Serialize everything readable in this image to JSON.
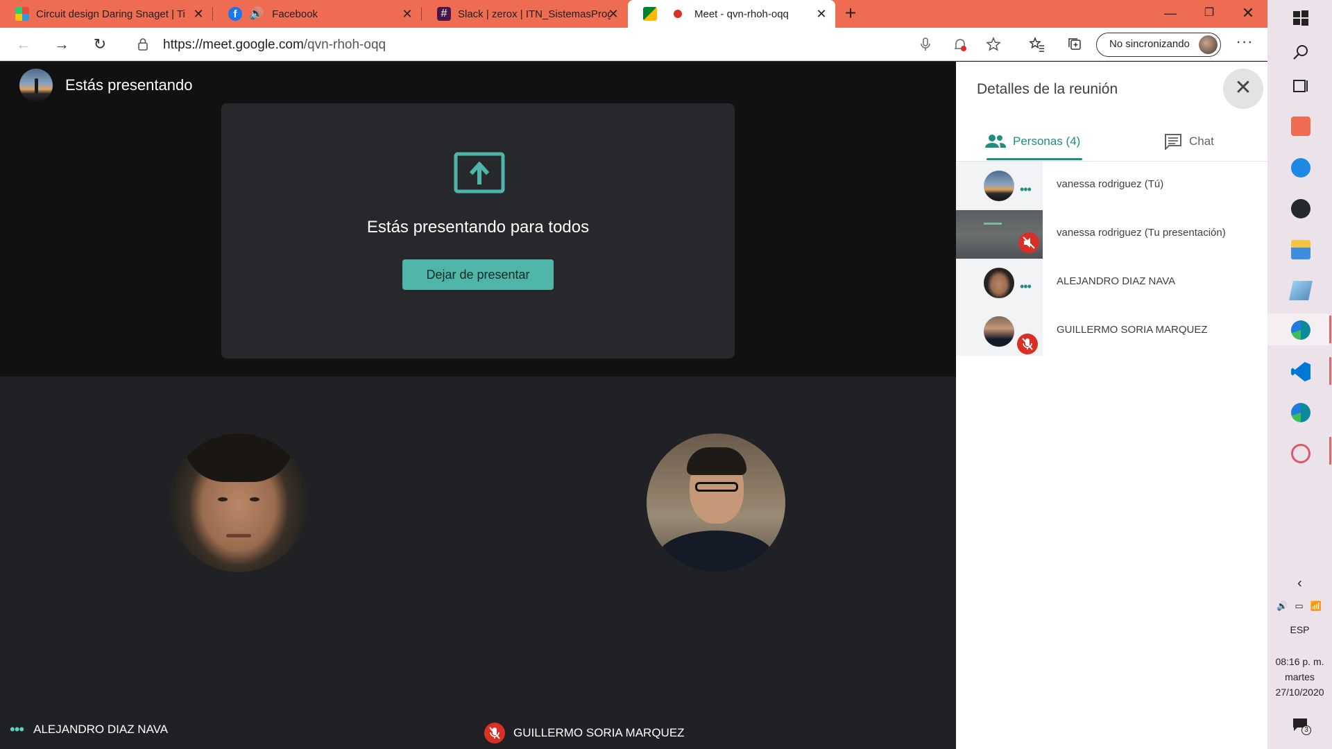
{
  "browser": {
    "tabs": [
      {
        "title": "Circuit design Daring Snaget | Ti",
        "favicon": "tinkercad-icon"
      },
      {
        "title": "Facebook",
        "favicon": "facebook-icon",
        "audio": true
      },
      {
        "title": "Slack | zerox | ITN_SistemasProgr",
        "favicon": "slack-icon"
      },
      {
        "title": "Meet - qvn-rhoh-oqq",
        "favicon": "meet-icon",
        "recording": true
      }
    ],
    "url_host": "https://meet.google.com",
    "url_path": "/qvn-rhoh-oqq",
    "sync_label": "No sincronizando"
  },
  "meet": {
    "presenting_header": "Estás presentando",
    "presenting_message": "Estás presentando para todos",
    "stop_button": "Dejar de presentar",
    "tiles": [
      {
        "name": "ALEJANDRO DIAZ NAVA",
        "status": "speaking-dots"
      },
      {
        "name": "GUILLERMO SORIA MARQUEZ",
        "status": "muted"
      }
    ]
  },
  "panel": {
    "title": "Detalles de la reunión",
    "tab_people": "Personas (4)",
    "tab_chat": "Chat",
    "people": [
      {
        "name": "vanessa rodriguez (Tú)",
        "indicator": "dots"
      },
      {
        "name": "vanessa rodriguez (Tu presentación)",
        "indicator": "audio-off"
      },
      {
        "name": "ALEJANDRO DIAZ NAVA",
        "indicator": "dots"
      },
      {
        "name": "GUILLERMO SORIA MARQUEZ",
        "indicator": "mic-off"
      }
    ]
  },
  "taskbar": {
    "language": "ESP",
    "time": "08:16 p. m.",
    "day": "martes",
    "date": "27/10/2020",
    "notifications": "3"
  },
  "colors": {
    "tab_bar": "#ee6c52",
    "meet_accent": "#4fb5a8",
    "people_tab": "#1e8e7e",
    "mute_red": "#d93025"
  }
}
